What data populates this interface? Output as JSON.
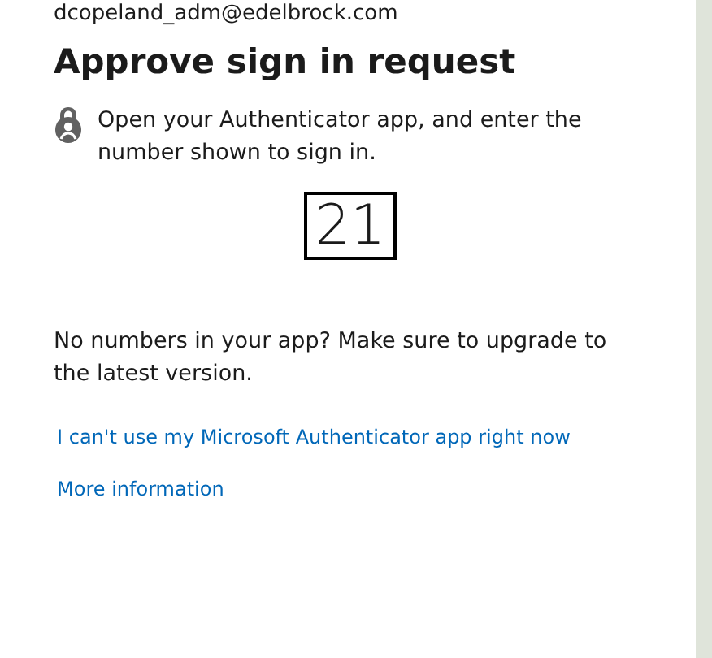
{
  "account": "dcopeland_adm@edelbrock.com",
  "title": "Approve sign in request",
  "instruction": "Open your Authenticator app, and enter the number shown to sign in.",
  "number": "21",
  "upgrade_note": "No numbers in your app? Make sure to upgrade to the latest version.",
  "links": [
    "I can't use my Microsoft Authenticator app right now",
    "More information"
  ]
}
